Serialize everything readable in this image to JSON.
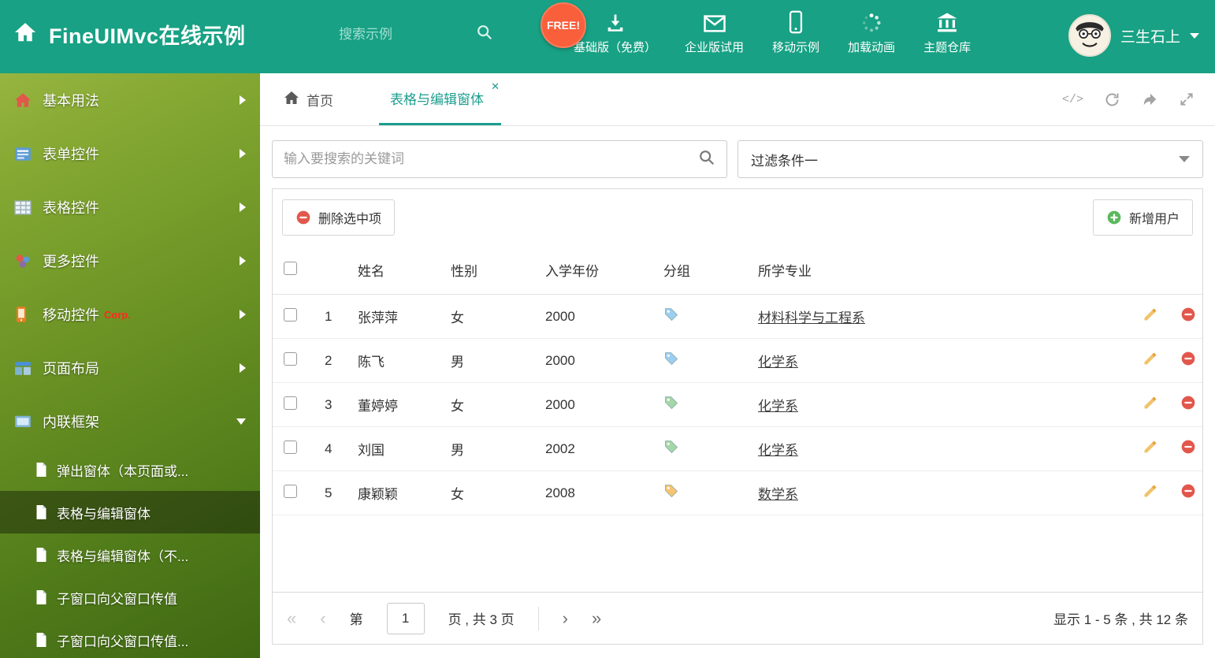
{
  "colors": {
    "brand_teal": "#18a184",
    "free_badge_orange": "#f95f3b",
    "active_tab_teal": "#1c9e8e",
    "delete_red": "#e2574c",
    "add_green": "#5cb85c",
    "pencil_orange": "#f0c36d"
  },
  "header": {
    "title": "FineUIMvc在线示例",
    "search_placeholder": "搜索示例",
    "free_badge": "FREE!",
    "nav": [
      {
        "icon": "download-icon",
        "label": "基础版（免费）"
      },
      {
        "icon": "envelope-icon",
        "label": "企业版试用"
      },
      {
        "icon": "mobile-icon",
        "label": "移动示例"
      },
      {
        "icon": "spinner-icon",
        "label": "加载动画"
      },
      {
        "icon": "bank-icon",
        "label": "主题仓库"
      }
    ],
    "user": {
      "name": "三生石上"
    }
  },
  "sidebar": {
    "items": [
      {
        "icon": "home-icon",
        "label": "基本用法"
      },
      {
        "icon": "form-icon",
        "label": "表单控件"
      },
      {
        "icon": "table-icon",
        "label": "表格控件"
      },
      {
        "icon": "widgets-icon",
        "label": "更多控件"
      },
      {
        "icon": "mobile-icon",
        "label": "移动控件",
        "badge": "Corp."
      },
      {
        "icon": "layout-icon",
        "label": "页面布局"
      },
      {
        "icon": "frame-icon",
        "label": "内联框架",
        "expanded": true,
        "children": [
          {
            "label": "弹出窗体（本页面或..."
          },
          {
            "label": "表格与编辑窗体",
            "active": true
          },
          {
            "label": "表格与编辑窗体（不..."
          },
          {
            "label": "子窗口向父窗口传值"
          },
          {
            "label": "子窗口向父窗口传值..."
          }
        ]
      }
    ]
  },
  "tabs": [
    {
      "label": "首页",
      "icon": "home-icon"
    },
    {
      "label": "表格与编辑窗体",
      "active": true,
      "close_glyph": "✕"
    }
  ],
  "tab_tools": {
    "code_glyph": "</>"
  },
  "main": {
    "search_placeholder": "输入要搜索的关键词",
    "filter_value": "过滤条件一",
    "toolbar": {
      "delete_label": "删除选中项",
      "add_label": "新增用户"
    },
    "table": {
      "columns": [
        "姓名",
        "性别",
        "入学年份",
        "分组",
        "所学专业"
      ],
      "rows": [
        {
          "num": "1",
          "name": "张萍萍",
          "gender": "女",
          "year": "2000",
          "tag_color": "#9ccef0",
          "major": "材料科学与工程系"
        },
        {
          "num": "2",
          "name": "陈飞",
          "gender": "男",
          "year": "2000",
          "tag_color": "#9ccef0",
          "major": "化学系"
        },
        {
          "num": "3",
          "name": "董婷婷",
          "gender": "女",
          "year": "2000",
          "tag_color": "#a5d6a7",
          "major": "化学系"
        },
        {
          "num": "4",
          "name": "刘国",
          "gender": "男",
          "year": "2002",
          "tag_color": "#a5d6a7",
          "major": "化学系"
        },
        {
          "num": "5",
          "name": "康颖颖",
          "gender": "女",
          "year": "2008",
          "tag_color": "#f8c471",
          "major": "数学系"
        }
      ]
    },
    "pagination": {
      "first_glyph": "«",
      "prev_glyph": "‹",
      "next_glyph": "›",
      "last_glyph": "»",
      "page_prefix": "第",
      "current_page": "1",
      "page_suffix": "页 , 共 3 页",
      "summary": "显示 1 - 5 条 , 共 12 条"
    }
  }
}
